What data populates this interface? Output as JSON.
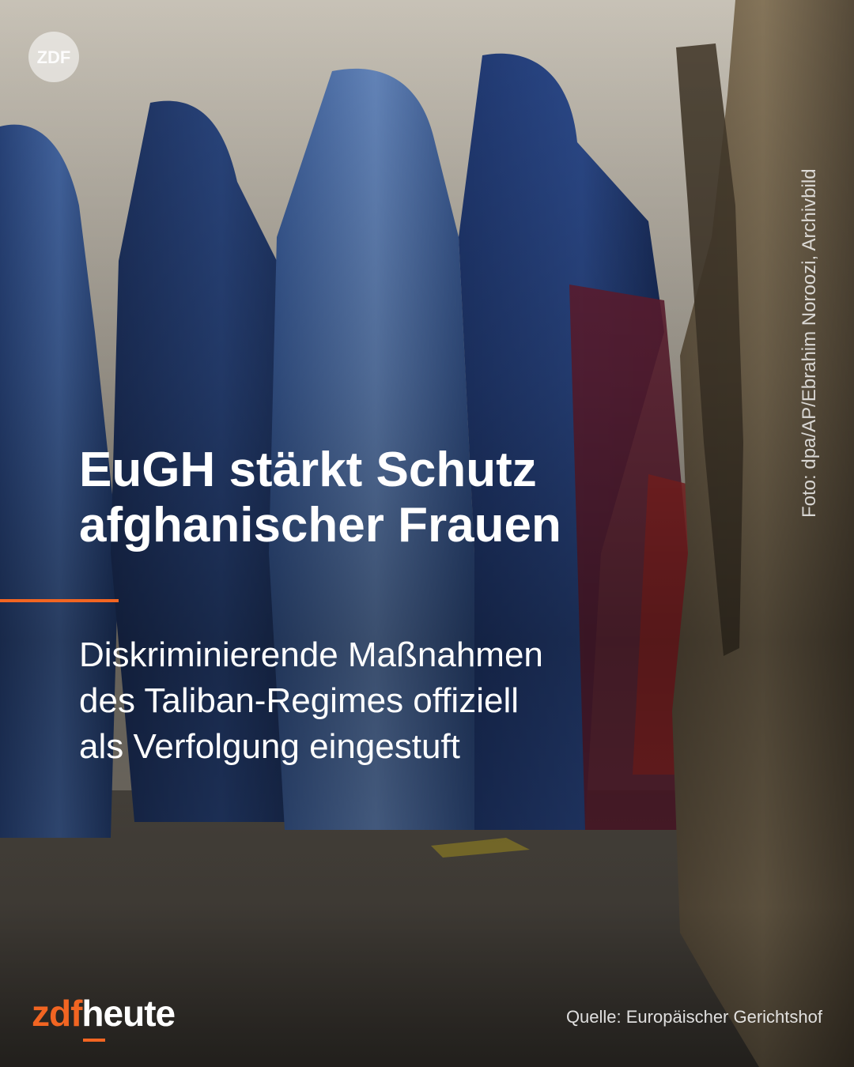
{
  "watermark": {
    "label": "ZDF"
  },
  "photo_credit": "Foto: dpa/AP/Ebrahim Noroozi, Archivbild",
  "headline": {
    "line1": "EuGH stärkt Schutz",
    "line2": "afghanischer Frauen"
  },
  "subline": {
    "line1": "Diskriminierende Maßnahmen",
    "line2": "des Taliban-Regimes offiziell",
    "line3": "als Verfolgung eingestuft"
  },
  "branding": {
    "zdf": "zdf",
    "heute": "heute"
  },
  "source": "Quelle: Europäischer Gerichtshof",
  "colors": {
    "accent": "#f26522",
    "text": "#ffffff"
  }
}
